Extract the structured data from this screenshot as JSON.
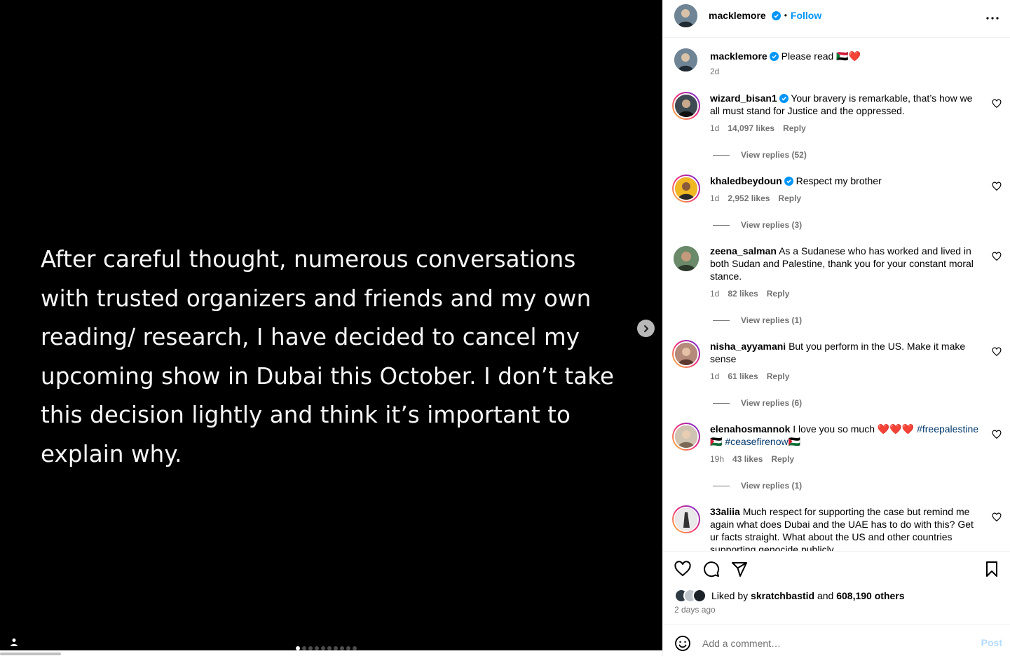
{
  "media": {
    "text": "After careful thought, numerous conversations with trusted organizers and friends and my own reading/ research, I have decided to cancel my upcoming show in Dubai this October. I don’t take this decision lightly and think it’s important to explain why.",
    "next_icon": "chevron-right-icon",
    "tag_icon": "user-tag-icon",
    "carousel_count": 10,
    "carousel_active_index": 0
  },
  "header": {
    "username": "macklemore",
    "separator": "•",
    "follow_label": "Follow",
    "more_icon": "more-horizontal-icon"
  },
  "caption": {
    "username": "macklemore",
    "text": "Please read 🇸🇩❤️",
    "time": "2d"
  },
  "comments": [
    {
      "username": "wizard_bisan1",
      "verified": true,
      "text": "Your bravery is remarkable, that’s how we all must stand for Justice and the oppressed.",
      "time": "1d",
      "likes": "14,097 likes",
      "reply_label": "Reply",
      "view_replies": "View replies (52)"
    },
    {
      "username": "khaledbeydoun",
      "verified": true,
      "text": "Respect my brother",
      "time": "1d",
      "likes": "2,952 likes",
      "reply_label": "Reply",
      "view_replies": "View replies (3)"
    },
    {
      "username": "zeena_salman",
      "verified": false,
      "text": "As a Sudanese who has worked and lived in both Sudan and Palestine, thank you for your constant moral stance.",
      "time": "1d",
      "likes": "82 likes",
      "reply_label": "Reply",
      "view_replies": "View replies (1)"
    },
    {
      "username": "nisha_ayyamani",
      "verified": false,
      "text": "But you perform in the US. Make it make sense",
      "time": "1d",
      "likes": "61 likes",
      "reply_label": "Reply",
      "view_replies": "View replies (6)"
    },
    {
      "username": "elenahosmannok",
      "verified": false,
      "text": "I love you so much ❤️❤️❤️",
      "hashtag1": "#freepalestine🇵🇸",
      "hashtag2": "#ceasefirenow🇵🇸",
      "time": "19h",
      "likes": "43 likes",
      "reply_label": "Reply",
      "view_replies": "View replies (1)"
    },
    {
      "username": "33aliia",
      "verified": false,
      "text": "Much respect for supporting the case but remind me again what does Dubai and the UAE has to do with this? Get ur facts straight. What about the US and other countries supporting genocide publicly",
      "time": "",
      "likes": "",
      "reply_label": "",
      "view_replies": ""
    }
  ],
  "actions": {
    "like_icon": "heart-icon",
    "comment_icon": "comment-icon",
    "share_icon": "send-icon",
    "save_icon": "bookmark-icon",
    "liked_by_prefix": "Liked by",
    "liked_by_user": "skratchbastid",
    "liked_by_and": "and",
    "liked_by_others": "608,190 others",
    "time_ago": "2 days ago"
  },
  "add_comment": {
    "emoji_icon": "emoji-icon",
    "placeholder": "Add a comment…",
    "post_label": "Post"
  },
  "colors": {
    "link_blue": "#0095f6",
    "hashtag": "#00376b",
    "muted": "#737373",
    "post_disabled": "#b3dbff"
  }
}
